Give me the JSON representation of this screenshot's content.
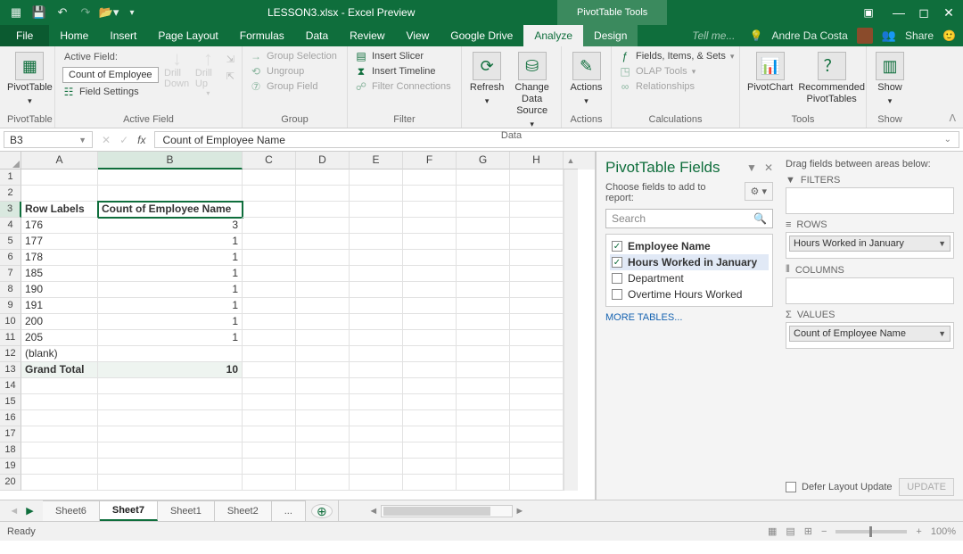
{
  "titlebar": {
    "doc_title": "LESSON3.xlsx - Excel Preview",
    "tool_tab": "PivotTable Tools"
  },
  "tabs": {
    "file": "File",
    "home": "Home",
    "insert": "Insert",
    "page_layout": "Page Layout",
    "formulas": "Formulas",
    "data": "Data",
    "review": "Review",
    "view": "View",
    "google_drive": "Google Drive",
    "analyze": "Analyze",
    "design": "Design",
    "tell_me": "Tell me...",
    "user": "Andre Da Costa",
    "share": "Share"
  },
  "ribbon": {
    "pivottable": {
      "label": "PivotTable",
      "btn": "PivotTable"
    },
    "active_field": {
      "label": "Active Field",
      "title": "Active Field:",
      "value": "Count of Employee",
      "settings": "Field Settings",
      "drill_down": "Drill Down",
      "drill_up": "Drill Up"
    },
    "group": {
      "label": "Group",
      "sel": "Group Selection",
      "ungroup": "Ungroup",
      "field": "Group Field"
    },
    "filter": {
      "label": "Filter",
      "slicer": "Insert Slicer",
      "timeline": "Insert Timeline",
      "conn": "Filter Connections"
    },
    "data": {
      "label": "Data",
      "refresh": "Refresh",
      "change": "Change Data Source"
    },
    "actions": {
      "label": "Actions",
      "btn": "Actions"
    },
    "calc": {
      "label": "Calculations",
      "fields": "Fields, Items, & Sets",
      "olap": "OLAP Tools",
      "rel": "Relationships"
    },
    "tools": {
      "label": "Tools",
      "chart": "PivotChart",
      "rec": "Recommended PivotTables"
    },
    "show": {
      "label": "Show",
      "btn": "Show"
    }
  },
  "namebox": "B3",
  "formula": "Count of Employee Name",
  "columns": [
    "A",
    "B",
    "C",
    "D",
    "E",
    "F",
    "G",
    "H"
  ],
  "sheet_rows": [
    {
      "n": 1,
      "a": "",
      "b": ""
    },
    {
      "n": 2,
      "a": "",
      "b": ""
    },
    {
      "n": 3,
      "a": "Row Labels",
      "b": "Count of Employee Name",
      "header": true
    },
    {
      "n": 4,
      "a": "176",
      "b": "3"
    },
    {
      "n": 5,
      "a": "177",
      "b": "1"
    },
    {
      "n": 6,
      "a": "178",
      "b": "1"
    },
    {
      "n": 7,
      "a": "185",
      "b": "1"
    },
    {
      "n": 8,
      "a": "190",
      "b": "1"
    },
    {
      "n": 9,
      "a": "191",
      "b": "1"
    },
    {
      "n": 10,
      "a": "200",
      "b": "1"
    },
    {
      "n": 11,
      "a": "205",
      "b": "1"
    },
    {
      "n": 12,
      "a": "(blank)",
      "b": ""
    },
    {
      "n": 13,
      "a": "Grand Total",
      "b": "10",
      "total": true
    },
    {
      "n": 14,
      "a": "",
      "b": ""
    },
    {
      "n": 15,
      "a": "",
      "b": ""
    },
    {
      "n": 16,
      "a": "",
      "b": ""
    },
    {
      "n": 17,
      "a": "",
      "b": ""
    },
    {
      "n": 18,
      "a": "",
      "b": ""
    },
    {
      "n": 19,
      "a": "",
      "b": ""
    },
    {
      "n": 20,
      "a": "",
      "b": ""
    }
  ],
  "pane": {
    "title": "PivotTable Fields",
    "choose": "Choose fields to add to report:",
    "search_placeholder": "Search",
    "fields": [
      {
        "label": "Employee Name",
        "checked": true,
        "bold": true
      },
      {
        "label": "Hours Worked in January",
        "checked": true,
        "bold": true,
        "hl": true
      },
      {
        "label": "Department",
        "checked": false
      },
      {
        "label": "Overtime Hours Worked",
        "checked": false
      }
    ],
    "more": "MORE TABLES...",
    "drag_hint": "Drag fields between areas below:",
    "filters": "FILTERS",
    "rows": "ROWS",
    "columns": "COLUMNS",
    "values": "VALUES",
    "row_item": "Hours Worked in January",
    "value_item": "Count of Employee Name",
    "defer": "Defer Layout Update",
    "update": "UPDATE"
  },
  "sheets": {
    "s6": "Sheet6",
    "s7": "Sheet7",
    "s1": "Sheet1",
    "s2": "Sheet2",
    "more": "..."
  },
  "status": {
    "ready": "Ready",
    "zoom": "100%"
  }
}
